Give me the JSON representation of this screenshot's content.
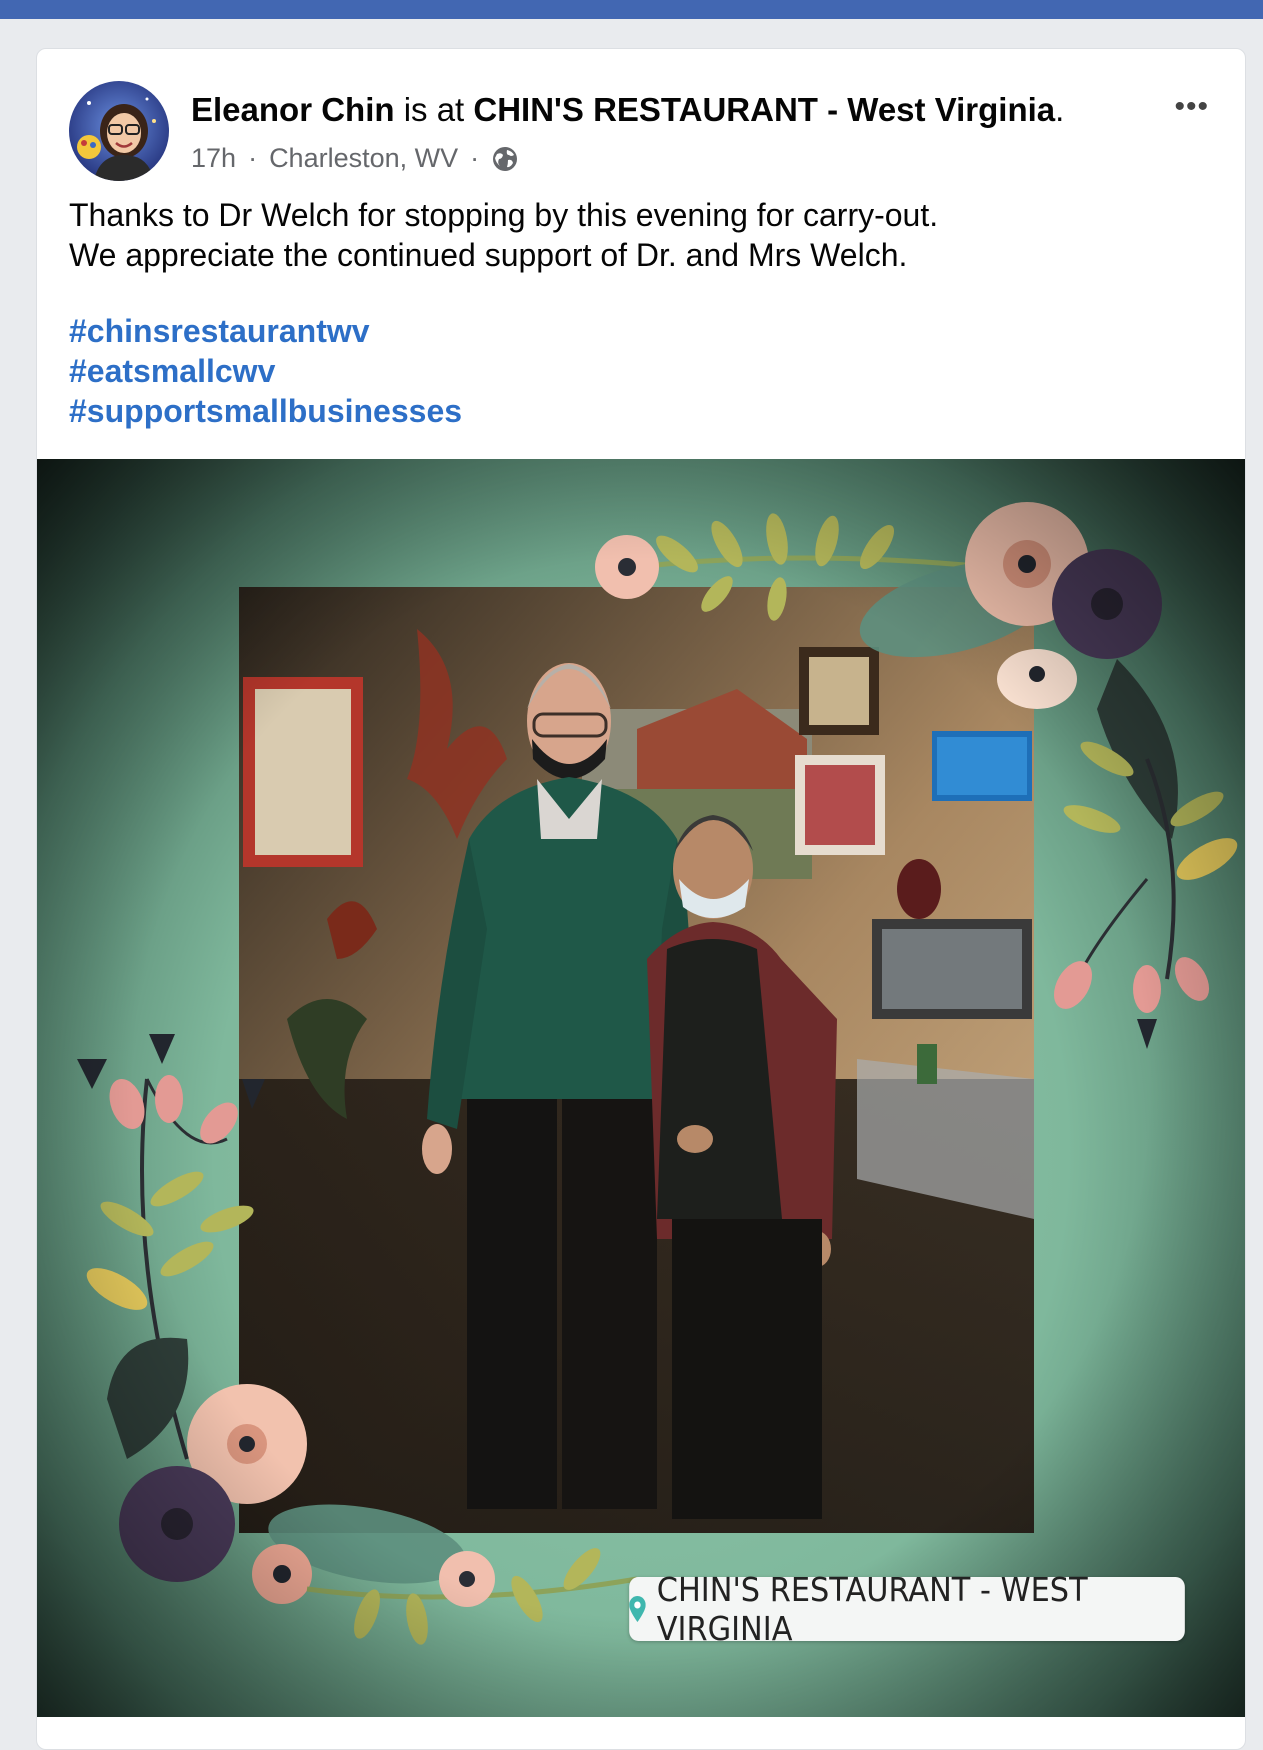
{
  "post": {
    "author": "Eleanor Chin",
    "connector": " is at ",
    "place": "CHIN'S RESTAURANT - West Virginia",
    "period": ".",
    "time": "17h",
    "location": "Charleston, WV",
    "separator": "·",
    "audience_icon": "globe-icon",
    "more_label": "•••",
    "text_line1": "Thanks to Dr Welch for stopping by this evening for carry-out.",
    "text_line2": "We appreciate the continued support of Dr. and Mrs Welch.",
    "hashtags": [
      "#chinsrestaurantwv",
      "#eatsmallcwv",
      "#supportsmallbusinesses"
    ]
  },
  "photo": {
    "location_sticker": "CHIN'S RESTAURANT - WEST VIRGINIA",
    "sticker_icon": "map-pin-icon"
  },
  "colors": {
    "brand_bar": "#4267b2",
    "hashtag": "#2d6fc7",
    "meta": "#65676b"
  }
}
